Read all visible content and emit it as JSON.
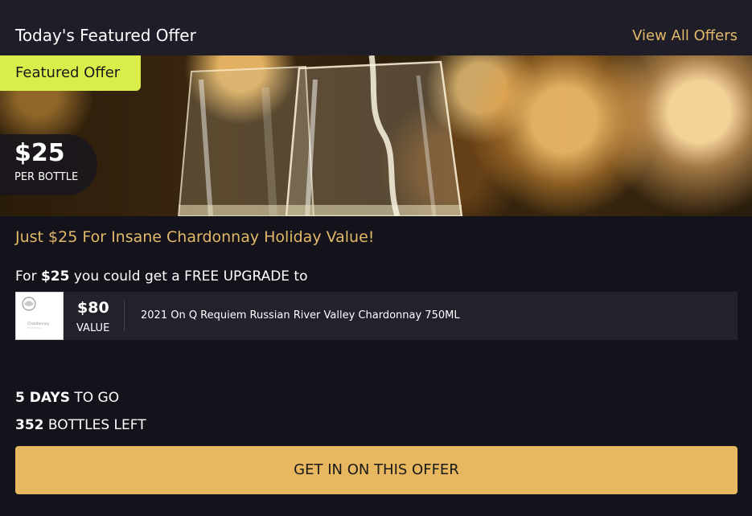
{
  "header": {
    "title": "Today's Featured Offer",
    "view_all_label": "View All Offers"
  },
  "hero": {
    "featured_tag": "Featured Offer",
    "price": "$25",
    "price_unit": "PER BOTTLE"
  },
  "offer": {
    "headline": "Just $25 For Insane Chardonnay Holiday Value!",
    "upgrade_prefix": "For",
    "upgrade_price": "$25",
    "upgrade_suffix": "you could get a FREE UPGRADE to"
  },
  "product": {
    "value_amount": "$80",
    "value_label": "VALUE",
    "name": "2021 On Q Requiem Russian River Valley Chardonnay 750ML",
    "label_brand": "Chardonnay"
  },
  "stats": {
    "days_value": "5 DAYS",
    "days_label": "TO GO",
    "bottles_value": "352",
    "bottles_label": "BOTTLES LEFT"
  },
  "cta": {
    "label": "GET IN ON THIS OFFER"
  },
  "colors": {
    "background": "#14131b",
    "header_bg": "#1f1e28",
    "accent_gold": "#e2b968",
    "cta_gold": "#e8b860",
    "tag_lime": "#d9ee4a"
  }
}
